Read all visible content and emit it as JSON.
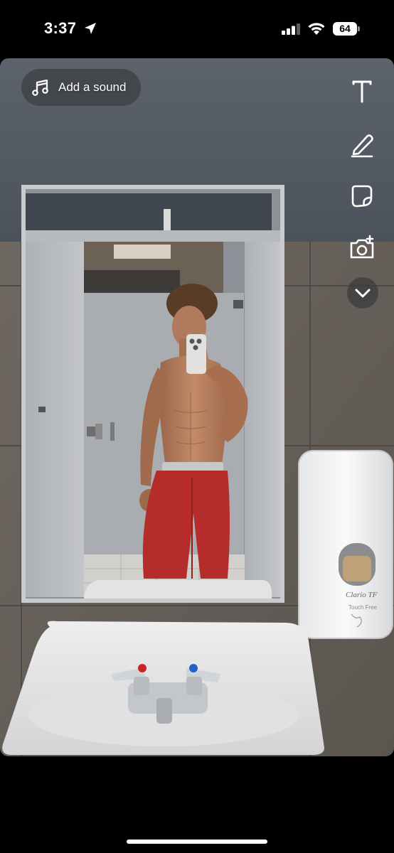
{
  "status_bar": {
    "time": "3:37",
    "battery_level": "64",
    "location_icon": "location-arrow-icon",
    "signal_icon": "cellular-signal-icon",
    "wifi_icon": "wifi-icon"
  },
  "sound_button": {
    "label": "Add a sound",
    "icon": "music-note-icon"
  },
  "tools": [
    {
      "name": "text-tool",
      "icon": "text-t-icon"
    },
    {
      "name": "draw-tool",
      "icon": "pencil-icon"
    },
    {
      "name": "sticker-tool",
      "icon": "sticker-icon"
    },
    {
      "name": "camera-tool",
      "icon": "camera-add-icon"
    },
    {
      "name": "more-tools",
      "icon": "chevron-down-icon"
    }
  ],
  "photo": {
    "dispenser_brand": "Clario TF",
    "dispenser_caption": "Touch Free"
  }
}
